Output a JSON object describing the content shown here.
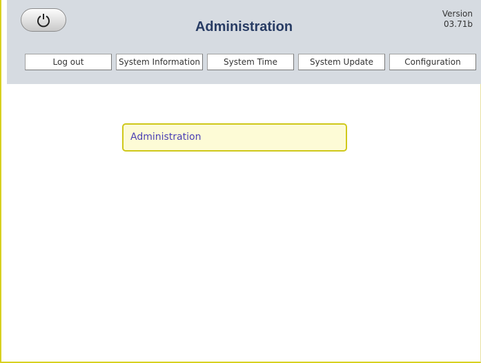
{
  "header": {
    "title": "Administration",
    "version_label": "Version",
    "version_number": "03.71b",
    "power_icon": "power-icon"
  },
  "nav": {
    "items": [
      {
        "label": "Log out"
      },
      {
        "label": "System Information"
      },
      {
        "label": "System Time"
      },
      {
        "label": "System Update"
      },
      {
        "label": "Configuration"
      }
    ]
  },
  "main": {
    "panel_title": "Administration"
  },
  "colors": {
    "header_bg": "#d6dbe1",
    "title_color": "#283c64",
    "panel_border": "#cfc81a",
    "panel_bg": "#fdfbd6",
    "panel_text": "#4a3fb5"
  }
}
